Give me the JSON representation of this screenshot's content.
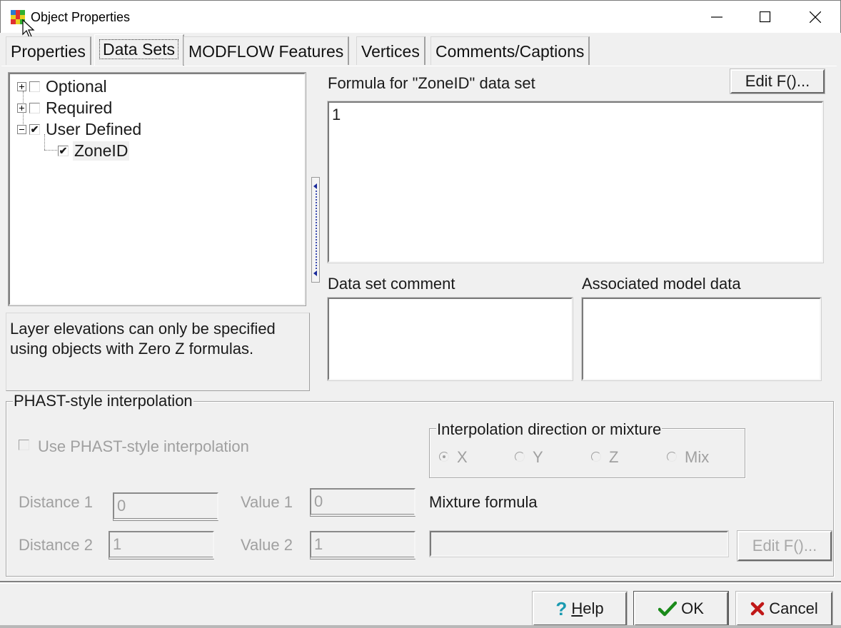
{
  "window": {
    "title": "Object Properties",
    "icon": "app-grid-icon",
    "controls": [
      "minimize-icon",
      "maximize-icon",
      "close-icon"
    ]
  },
  "tabs": [
    {
      "label": "Properties",
      "active": false
    },
    {
      "label": "Data Sets",
      "active": true
    },
    {
      "label": "MODFLOW Features",
      "active": false
    },
    {
      "label": "Vertices",
      "active": false
    },
    {
      "label": "Comments/Captions",
      "active": false
    }
  ],
  "tree": {
    "items": [
      {
        "label": "Optional",
        "expanded": false,
        "checked": false,
        "level": 0
      },
      {
        "label": "Required",
        "expanded": false,
        "checked": false,
        "level": 0
      },
      {
        "label": "User Defined",
        "expanded": true,
        "checked": true,
        "level": 0
      },
      {
        "label": "ZoneID",
        "checked": true,
        "level": 1,
        "selected": true
      }
    ]
  },
  "note": "Layer elevations can only be specified using objects with Zero Z formulas.",
  "formula": {
    "label": "Formula for \"ZoneID\" data set",
    "value": "1",
    "edit_button": "Edit F()..."
  },
  "comment": {
    "label": "Data set comment",
    "value": ""
  },
  "associated": {
    "label": "Associated model data",
    "value": ""
  },
  "phast": {
    "group_title": "PHAST-style interpolation",
    "use_checkbox": {
      "label": "Use PHAST-style interpolation",
      "checked": false,
      "enabled": false
    },
    "direction_group": {
      "title": "Interpolation direction or mixture",
      "options": [
        {
          "label": "X",
          "selected": true
        },
        {
          "label": "Y",
          "selected": false
        },
        {
          "label": "Z",
          "selected": false
        },
        {
          "label": "Mix",
          "selected": false
        }
      ]
    },
    "distance1": {
      "label": "Distance 1",
      "value": "0"
    },
    "distance2": {
      "label": "Distance 2",
      "value": "1"
    },
    "value1": {
      "label": "Value 1",
      "value": "0"
    },
    "value2": {
      "label": "Value 2",
      "value": "1"
    },
    "mixture": {
      "label": "Mixture formula",
      "value": "",
      "edit_button": "Edit F()..."
    }
  },
  "buttons": {
    "help": {
      "label_hotkey": "H",
      "label_rest": "elp",
      "icon": "help-icon",
      "color": "#1a9ab0"
    },
    "ok": {
      "label": "OK",
      "icon": "check-icon",
      "color": "#1a8a1a"
    },
    "cancel": {
      "label": "Cancel",
      "icon": "x-icon",
      "color": "#c01818"
    }
  }
}
